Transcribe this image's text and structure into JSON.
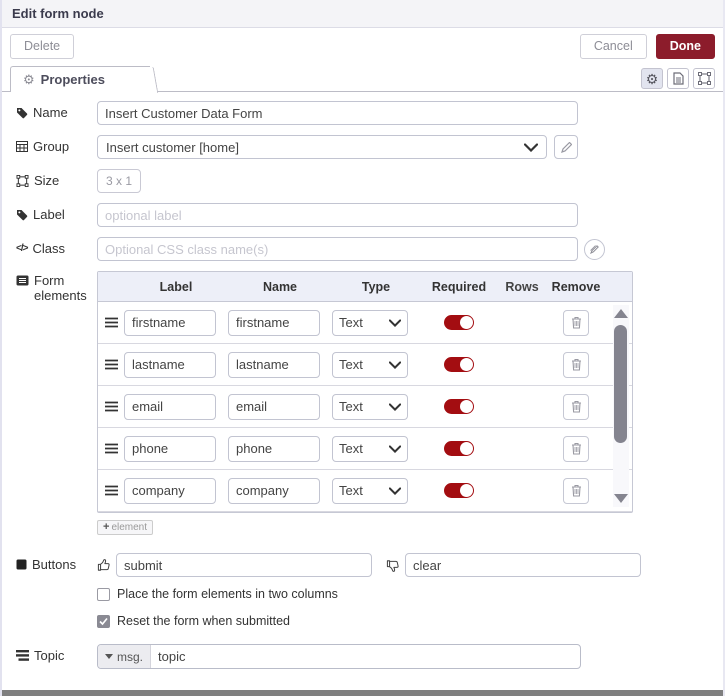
{
  "header": {
    "title": "Edit form node"
  },
  "toolbar": {
    "delete_label": "Delete",
    "cancel_label": "Cancel",
    "done_label": "Done"
  },
  "tabs": {
    "properties_label": "Properties"
  },
  "fields": {
    "name": {
      "label": "Name",
      "value": "Insert Customer Data Form"
    },
    "group": {
      "label": "Group",
      "value": "Insert customer [home]"
    },
    "size": {
      "label": "Size",
      "value": "3 x 1"
    },
    "label": {
      "label": "Label",
      "value": "",
      "placeholder": "optional label"
    },
    "class": {
      "label": "Class",
      "value": "",
      "placeholder": "Optional CSS class name(s)"
    }
  },
  "form_elements": {
    "label": "Form elements",
    "columns": [
      "Label",
      "Name",
      "Type",
      "Required",
      "Rows",
      "Remove"
    ],
    "rows": [
      {
        "label": "firstname",
        "name": "firstname",
        "type": "Text",
        "required": true,
        "rows": ""
      },
      {
        "label": "lastname",
        "name": "lastname",
        "type": "Text",
        "required": true,
        "rows": ""
      },
      {
        "label": "email",
        "name": "email",
        "type": "Text",
        "required": true,
        "rows": ""
      },
      {
        "label": "phone",
        "name": "phone",
        "type": "Text",
        "required": true,
        "rows": ""
      },
      {
        "label": "company",
        "name": "company",
        "type": "Text",
        "required": true,
        "rows": ""
      }
    ],
    "add_button": {
      "plus": "+",
      "label": "element"
    }
  },
  "buttons_section": {
    "label": "Buttons",
    "submit_value": "submit",
    "clear_value": "clear"
  },
  "checkboxes": [
    {
      "label": "Place the form elements in two columns",
      "checked": false
    },
    {
      "label": "Reset the form when submitted",
      "checked": true
    }
  ],
  "topic": {
    "label": "Topic",
    "prefix": "msg.",
    "value": "topic"
  },
  "icons": {
    "name": "tag-icon",
    "group": "table-icon",
    "size": "object-group-icon",
    "label": "tag-icon",
    "class": "code-icon",
    "form_elements": "list-alt-icon",
    "buttons": "square-icon",
    "topic": "tasks-icon",
    "properties_tab": "gear-icon",
    "submit": "thumbs-up-icon",
    "clear": "thumbs-down-icon"
  },
  "colors": {
    "accent_maroon": "#8C1C2B",
    "toggle_on": "#A30D11",
    "table_header_bg": "#edeff8",
    "titlebar_bg": "#f4f4f7"
  }
}
